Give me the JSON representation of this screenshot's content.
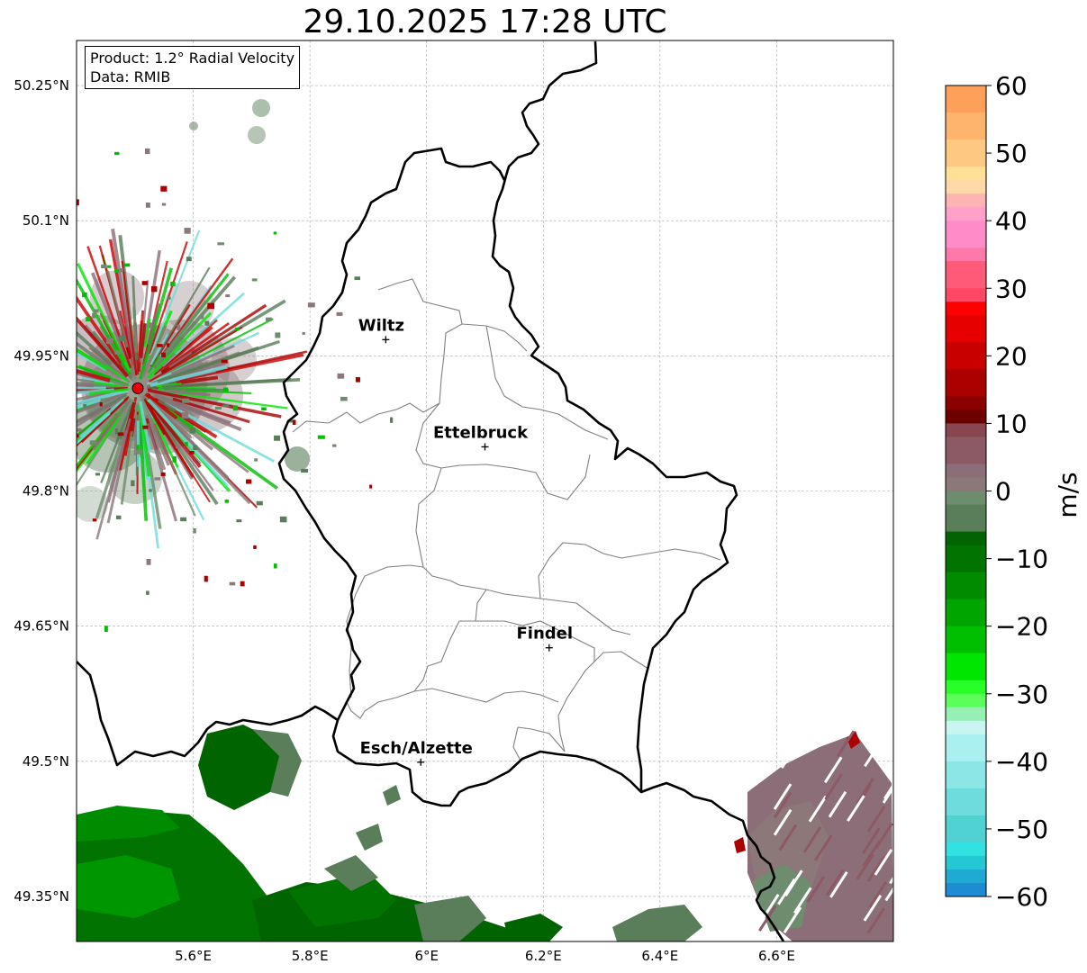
{
  "title": "29.10.2025 17:28 UTC",
  "info": {
    "product_line": "Product: 1.2° Radial Velocity",
    "data_line": "Data: RMIB"
  },
  "map": {
    "lon_range": [
      5.4,
      6.8
    ],
    "lat_range": [
      49.3,
      50.3
    ],
    "lon_ticks": [
      {
        "value": 5.6,
        "label": "5.6°E"
      },
      {
        "value": 5.8,
        "label": "5.8°E"
      },
      {
        "value": 6.0,
        "label": "6°E"
      },
      {
        "value": 6.2,
        "label": "6.2°E"
      },
      {
        "value": 6.4,
        "label": "6.4°E"
      },
      {
        "value": 6.6,
        "label": "6.6°E"
      }
    ],
    "lat_ticks": [
      {
        "value": 50.25,
        "label": "50.25°N"
      },
      {
        "value": 50.1,
        "label": "50.1°N"
      },
      {
        "value": 49.95,
        "label": "49.95°N"
      },
      {
        "value": 49.8,
        "label": "49.8°N"
      },
      {
        "value": 49.65,
        "label": "49.65°N"
      },
      {
        "value": 49.5,
        "label": "49.5°N"
      },
      {
        "value": 49.35,
        "label": "49.35°N"
      }
    ],
    "cities": [
      {
        "name": "Wiltz",
        "lon": 5.93,
        "lat": 49.968
      },
      {
        "name": "Ettelbruck",
        "lon": 6.1,
        "lat": 49.849
      },
      {
        "name": "Findel",
        "lon": 6.21,
        "lat": 49.626
      },
      {
        "name": "Esch/Alzette",
        "lon": 5.99,
        "lat": 49.499
      }
    ],
    "radar_site": {
      "lon": 5.505,
      "lat": 49.914,
      "color": "#e8000b"
    }
  },
  "colorbar": {
    "label": "m/s",
    "min": -60,
    "max": 60,
    "ticks": [
      {
        "value": 60,
        "label": "60"
      },
      {
        "value": 50,
        "label": "50"
      },
      {
        "value": 40,
        "label": "40"
      },
      {
        "value": 30,
        "label": "30"
      },
      {
        "value": 20,
        "label": "20"
      },
      {
        "value": 10,
        "label": "10"
      },
      {
        "value": 0,
        "label": "0"
      },
      {
        "value": -10,
        "label": "−10"
      },
      {
        "value": -20,
        "label": "−20"
      },
      {
        "value": -30,
        "label": "−30"
      },
      {
        "value": -40,
        "label": "−40"
      },
      {
        "value": -50,
        "label": "−50"
      },
      {
        "value": -60,
        "label": "−60"
      }
    ],
    "bands": [
      {
        "from": 56,
        "to": 60,
        "color": "#ffa05a"
      },
      {
        "from": 52,
        "to": 56,
        "color": "#ffb46e"
      },
      {
        "from": 48,
        "to": 52,
        "color": "#ffc882"
      },
      {
        "from": 46,
        "to": 48,
        "color": "#ffe096"
      },
      {
        "from": 44,
        "to": 46,
        "color": "#ffd8a8"
      },
      {
        "from": 42,
        "to": 44,
        "color": "#ffb4b4"
      },
      {
        "from": 40,
        "to": 42,
        "color": "#ffa0c8"
      },
      {
        "from": 36,
        "to": 40,
        "color": "#ff8cc8"
      },
      {
        "from": 34,
        "to": 36,
        "color": "#ff78aa"
      },
      {
        "from": 30,
        "to": 34,
        "color": "#ff5a78"
      },
      {
        "from": 28,
        "to": 30,
        "color": "#ff4664"
      },
      {
        "from": 26,
        "to": 28,
        "color": "#ff0000"
      },
      {
        "from": 22,
        "to": 26,
        "color": "#e60000"
      },
      {
        "from": 18,
        "to": 22,
        "color": "#c80000"
      },
      {
        "from": 14,
        "to": 18,
        "color": "#aa0000"
      },
      {
        "from": 12,
        "to": 14,
        "color": "#8c0000"
      },
      {
        "from": 10,
        "to": 12,
        "color": "#6e0000"
      },
      {
        "from": 8,
        "to": 10,
        "color": "#874650"
      },
      {
        "from": 4,
        "to": 8,
        "color": "#8c5a64"
      },
      {
        "from": 2,
        "to": 4,
        "color": "#8c6e78"
      },
      {
        "from": 0,
        "to": 2,
        "color": "#8c7878"
      },
      {
        "from": -2,
        "to": 0,
        "color": "#6e8c6e"
      },
      {
        "from": -6,
        "to": -2,
        "color": "#5a7d5a"
      },
      {
        "from": -8,
        "to": -6,
        "color": "#006400"
      },
      {
        "from": -12,
        "to": -8,
        "color": "#007300"
      },
      {
        "from": -16,
        "to": -12,
        "color": "#008c00"
      },
      {
        "from": -20,
        "to": -16,
        "color": "#00a500"
      },
      {
        "from": -24,
        "to": -20,
        "color": "#00be00"
      },
      {
        "from": -28,
        "to": -24,
        "color": "#00e600"
      },
      {
        "from": -30,
        "to": -28,
        "color": "#28ff28"
      },
      {
        "from": -32,
        "to": -30,
        "color": "#5aff5a"
      },
      {
        "from": -34,
        "to": -32,
        "color": "#96f0b4"
      },
      {
        "from": -36,
        "to": -34,
        "color": "#c8f5f0"
      },
      {
        "from": -40,
        "to": -36,
        "color": "#aaf0f0"
      },
      {
        "from": -44,
        "to": -40,
        "color": "#8ce6e6"
      },
      {
        "from": -48,
        "to": -44,
        "color": "#6edcdc"
      },
      {
        "from": -52,
        "to": -48,
        "color": "#50d2d2"
      },
      {
        "from": -54,
        "to": -52,
        "color": "#32e1e1"
      },
      {
        "from": -56,
        "to": -54,
        "color": "#23c8d2"
      },
      {
        "from": -58,
        "to": -56,
        "color": "#1eaad2"
      },
      {
        "from": -60,
        "to": -58,
        "color": "#1e8cd2"
      }
    ]
  }
}
